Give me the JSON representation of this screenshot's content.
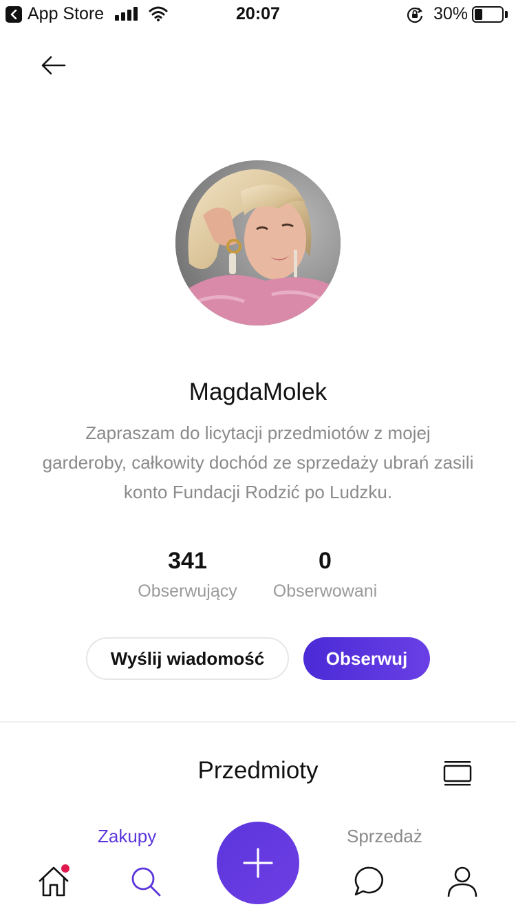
{
  "status_bar": {
    "back_app": "App Store",
    "time": "20:07",
    "battery_percent": "30%",
    "battery_level": 0.3
  },
  "profile": {
    "username": "MagdaMolek",
    "bio": "Zapraszam do licytacji przedmiotów z mojej garderoby, całkowity dochód ze sprzedaży ubrań zasili konto Fundacji Rodzić po Ludzku.",
    "followers_count": "341",
    "followers_label": "Obserwujący",
    "following_count": "0",
    "following_label": "Obserwowani"
  },
  "actions": {
    "message_label": "Wyślij wiadomość",
    "follow_label": "Obserwuj"
  },
  "items": {
    "title": "Przedmioty",
    "tabs": [
      {
        "label": "Zakupy",
        "active": true
      },
      {
        "label": "Sprzedaż",
        "active": false
      }
    ]
  },
  "bottom_nav": {
    "items": [
      "home-icon",
      "search-icon",
      "plus-icon",
      "chat-icon",
      "profile-icon"
    ],
    "home_has_notification": true,
    "accent_color": "#5b35dc"
  }
}
